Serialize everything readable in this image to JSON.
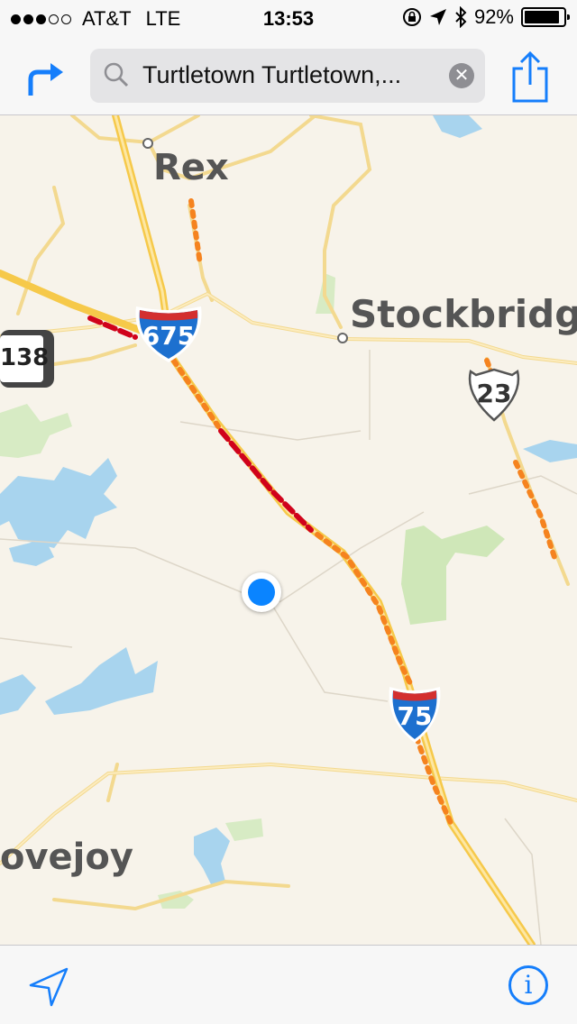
{
  "status_bar": {
    "signal_dots_filled": 3,
    "signal_dots_total": 5,
    "carrier": "AT&T",
    "network": "LTE",
    "time": "13:53",
    "icons": [
      "orientation-lock-icon",
      "location-arrow-icon",
      "bluetooth-icon"
    ],
    "battery_percent": "92%",
    "battery_level": 0.92
  },
  "nav_bar": {
    "directions_icon": "directions-arrow-icon",
    "search": {
      "value": "Turtletown Turtletown,..."
    },
    "clear_icon": "clear-icon",
    "share_icon": "share-icon"
  },
  "map": {
    "places": {
      "rex": "Rex",
      "stockbridge": "Stockbridg",
      "lovejoy": "ovejoy"
    },
    "shields": {
      "i675": "675",
      "i75": "75",
      "us23": "23",
      "sr138": "138"
    },
    "colors": {
      "land": "#f7f3ea",
      "water": "#a8d4ee",
      "park": "#d7ebc4",
      "highway": "#f6c94a",
      "road": "#fbe3a8",
      "traffic_heavy": "#d0021b",
      "traffic_moderate": "#f5831f",
      "interstate_blue": "#1d70cf",
      "interstate_red": "#d32f2f",
      "user_location": "#0a84ff"
    }
  },
  "toolbar": {
    "location_icon": "location-arrow-icon",
    "info_label": "i"
  }
}
